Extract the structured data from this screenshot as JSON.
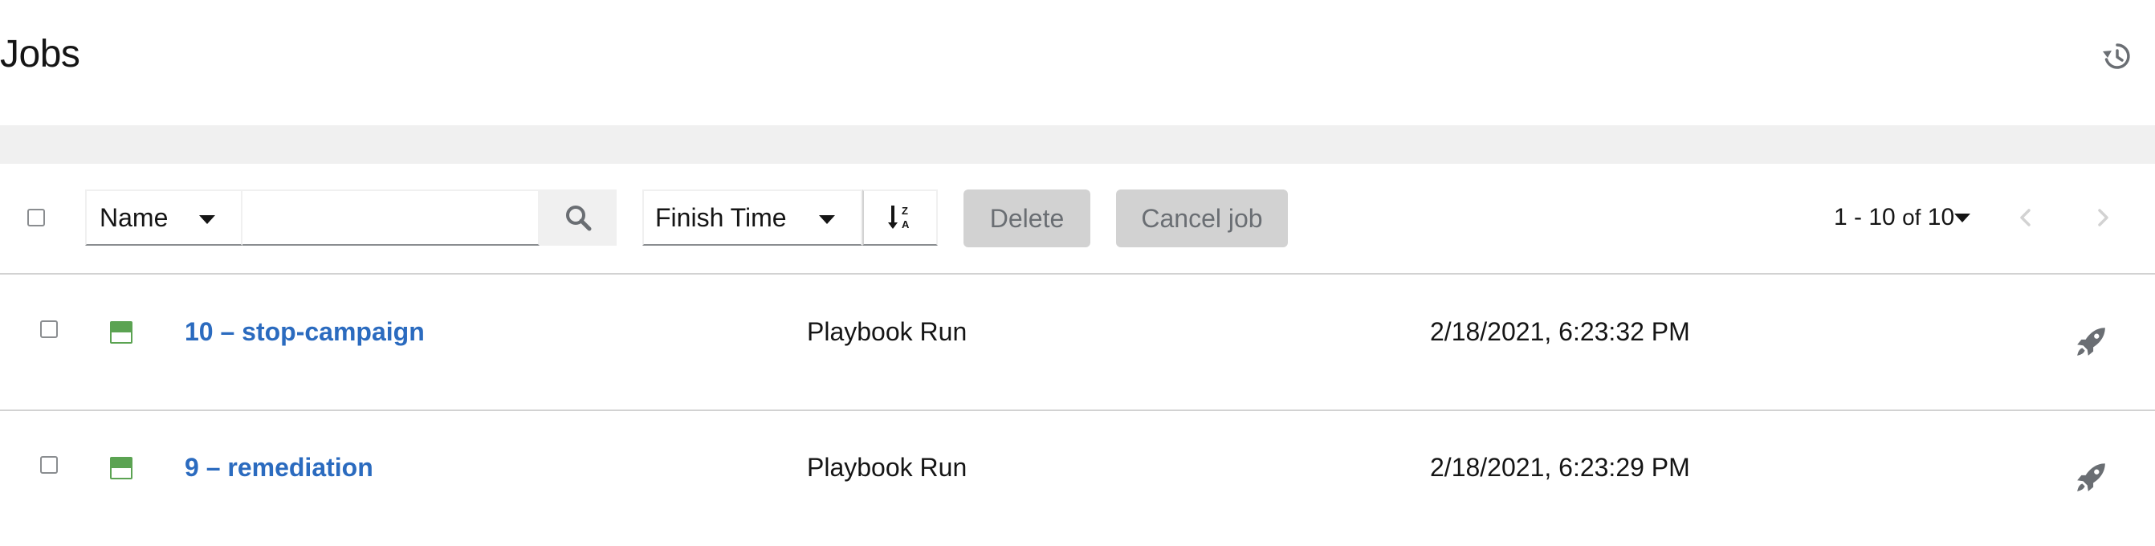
{
  "page": {
    "title": "Jobs"
  },
  "toolbar": {
    "filter_field": "Name",
    "search_value": "",
    "sort_field": "Finish Time",
    "delete_label": "Delete",
    "cancel_label": "Cancel job"
  },
  "pagination": {
    "range": "1 - 10",
    "of": "of",
    "total": "10"
  },
  "jobs": [
    {
      "name": "10 – stop-campaign",
      "type": "Playbook Run",
      "finished": "2/18/2021, 6:23:32 PM",
      "status": "successful"
    },
    {
      "name": "9 – remediation",
      "type": "Playbook Run",
      "finished": "2/18/2021, 6:23:29 PM",
      "status": "successful"
    }
  ],
  "icons": {
    "history": "history-icon",
    "search": "search-icon",
    "sort": "sort-alpha-desc-icon",
    "relaunch": "rocket-icon",
    "prev": "chevron-left-icon",
    "next": "chevron-right-icon"
  },
  "colors": {
    "link": "#2b6bbf",
    "success": "#5ba352",
    "disabled_button": "#d2d2d2"
  }
}
